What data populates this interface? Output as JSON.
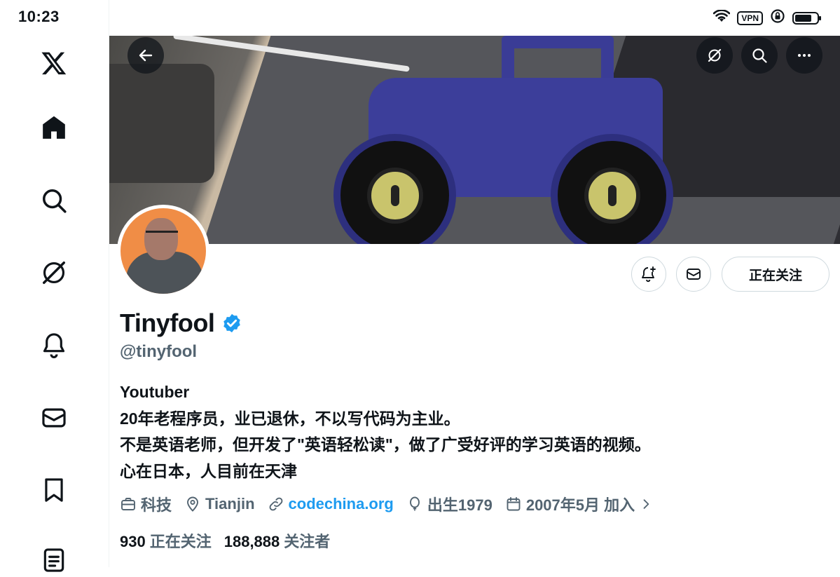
{
  "status_bar": {
    "time": "10:23",
    "vpn_label": "VPN",
    "battery_level": 0.68
  },
  "sidebar": {
    "items": [
      {
        "name": "x-logo-icon"
      },
      {
        "name": "home-icon"
      },
      {
        "name": "search-icon"
      },
      {
        "name": "grok-icon"
      },
      {
        "name": "notifications-icon"
      },
      {
        "name": "messages-icon"
      },
      {
        "name": "bookmarks-icon"
      },
      {
        "name": "lists-icon"
      }
    ]
  },
  "profile": {
    "display_name": "Tinyfool",
    "verified": true,
    "handle": "@tinyfool",
    "follow_button_label": "正在关注",
    "bio": [
      "Youtuber",
      "20年老程序员，业已退休，不以写代码为主业。",
      "不是英语老师，但开发了\"英语轻松读\"，做了广受好评的学习英语的视频。",
      "心在日本，人目前在天津"
    ],
    "meta": {
      "category": "科技",
      "location": "Tianjin",
      "website": "codechina.org",
      "birth": "出生1979",
      "joined": "2007年5月 加入"
    },
    "following_count": "930",
    "following_label": "正在关注",
    "followers_count": "188,888",
    "followers_label": "关注者"
  },
  "colors": {
    "text_primary": "#0f1419",
    "text_secondary": "#536471",
    "link": "#1d9bf0",
    "verified": "#1d9bf0",
    "border": "#cfd9de"
  }
}
